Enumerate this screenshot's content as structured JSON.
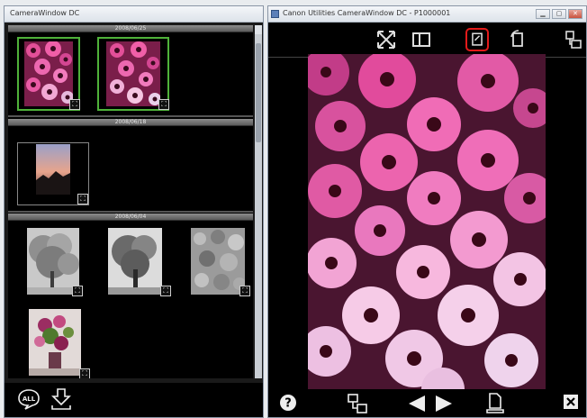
{
  "left_window": {
    "title": "CameraWindow DC",
    "groups": [
      {
        "header": "2008/06/25",
        "thumbnails": [
          "thumb-flowers-1",
          "thumb-flowers-2"
        ],
        "selected": [
          0,
          1
        ]
      },
      {
        "header": "2008/06/18",
        "thumbnails": [
          "thumb-sunset"
        ]
      },
      {
        "header": "2008/06/04",
        "thumbnails": [
          "thumb-tree-1",
          "thumb-tree-2",
          "thumb-rocks",
          "thumb-bouquet"
        ]
      }
    ],
    "bottom_toolbar": {
      "all_label": "ALL",
      "icons": [
        "select-all-icon",
        "import-icon"
      ]
    }
  },
  "right_window": {
    "title": "Canon Utilities CameraWindow DC - P1000001",
    "window_buttons": [
      "minimize",
      "maximize",
      "close"
    ],
    "toolbar": {
      "icons": [
        "fullscreen-icon",
        "layout-icon",
        "edit-icon",
        "rotate-icon",
        "share-icon"
      ],
      "highlighted": "edit-icon"
    },
    "bottom_toolbar": {
      "icons": [
        "help-icon",
        "transfer-icon",
        "previous-icon",
        "next-icon",
        "export-icon",
        "close-icon"
      ],
      "help_label": "?"
    }
  },
  "colors": {
    "selection_border": "#4fb23a",
    "highlight_border": "#e21a1a",
    "background": "#000000"
  }
}
